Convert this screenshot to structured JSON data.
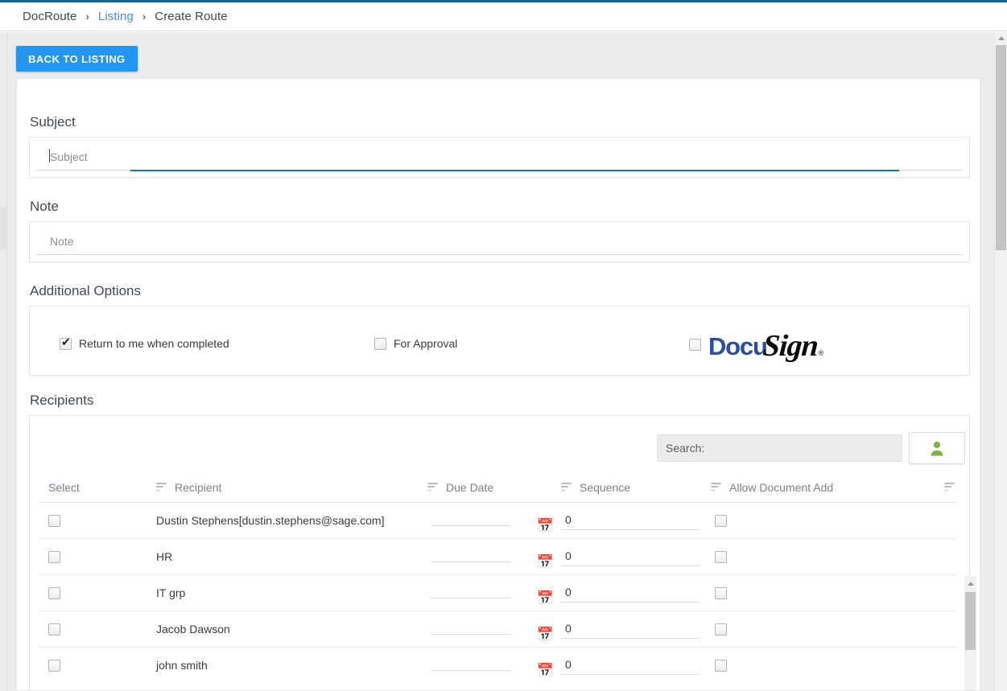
{
  "breadcrumb": {
    "root": "DocRoute",
    "separator": "›",
    "middle": "Listing",
    "current": "Create Route"
  },
  "toolbar": {
    "back_label": "BACK TO LISTING"
  },
  "form": {
    "subject": {
      "label": "Subject",
      "value": "",
      "placeholder": "Subject"
    },
    "note": {
      "label": "Note",
      "value": "",
      "placeholder": "Note"
    },
    "additional_options": {
      "label": "Additional Options",
      "return_to_me": {
        "label": "Return to me when completed",
        "checked": true
      },
      "for_approval": {
        "label": "For Approval",
        "checked": false
      },
      "docusign": {
        "label_part1": "Docu",
        "label_part2": "Sign",
        "registered": "®",
        "checked": false
      }
    }
  },
  "recipients": {
    "label": "Recipients",
    "search": {
      "placeholder": "Search:",
      "value": ""
    },
    "add_user_button": "add-user-icon",
    "columns": [
      "Select",
      "Recipient",
      "Due Date",
      "Sequence",
      "Allow Document Add"
    ],
    "rows": [
      {
        "selected": false,
        "recipient": "Dustin Stephens[dustin.stephens@sage.com]",
        "due_date": "",
        "sequence": "0",
        "allow_document_add": false
      },
      {
        "selected": false,
        "recipient": "HR",
        "due_date": "",
        "sequence": "0",
        "allow_document_add": false
      },
      {
        "selected": false,
        "recipient": "IT grp",
        "due_date": "",
        "sequence": "0",
        "allow_document_add": false
      },
      {
        "selected": false,
        "recipient": "Jacob Dawson",
        "due_date": "",
        "sequence": "0",
        "allow_document_add": false
      },
      {
        "selected": false,
        "recipient": "john smith",
        "due_date": "",
        "sequence": "0",
        "allow_document_add": false
      }
    ]
  },
  "colors": {
    "accent_blue": "#2196f3",
    "top_bar": "#16688e",
    "link": "#4d90c4",
    "focus_underline": "#1a73c0",
    "docusign_blue": "#2b4ea2",
    "add_user_green": "#7cb342"
  }
}
